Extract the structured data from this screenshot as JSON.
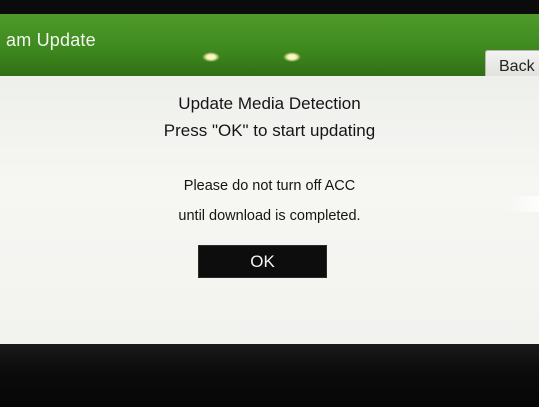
{
  "header": {
    "title": "am Update",
    "back_label": "Back"
  },
  "dialog": {
    "title": "Update Media Detection",
    "subtitle": "Press \"OK\" to start updating",
    "warning_line_1": "Please do not turn off ACC",
    "warning_line_2": "until download is completed.",
    "ok_label": "OK"
  },
  "colors": {
    "header_green": "#3f8a1f",
    "dialog_background": "#f4f4f1",
    "ok_button_background": "#0d0d0d",
    "bezel": "#0b0b0b"
  }
}
